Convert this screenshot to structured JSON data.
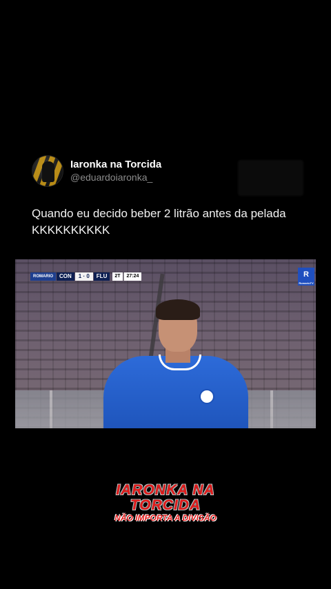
{
  "tweet": {
    "display_name": "Iaronka na Torcida",
    "handle": "@eduardoiaronka_",
    "text": "Quando eu decido beber 2 litrão antes da pelada KKKKKKKKKK",
    "avatar_icon": "profile-photo"
  },
  "video": {
    "scoreboard": {
      "sponsor": "ROMARIO",
      "home": "CON",
      "score": "1 · 0",
      "away": "FLU",
      "half": "2T",
      "time": "27:24"
    },
    "channel_logo": "R",
    "channel_logo_small": "RomarioTV"
  },
  "watermark": {
    "line1": "IARONKA NA",
    "line2": "TORCIDA",
    "line3": "NÃO IMPORTA A DIVISÃO"
  },
  "colors": {
    "background": "#000000",
    "watermark_red": "#e21b1b",
    "kit_blue": "#2d6bd9"
  }
}
